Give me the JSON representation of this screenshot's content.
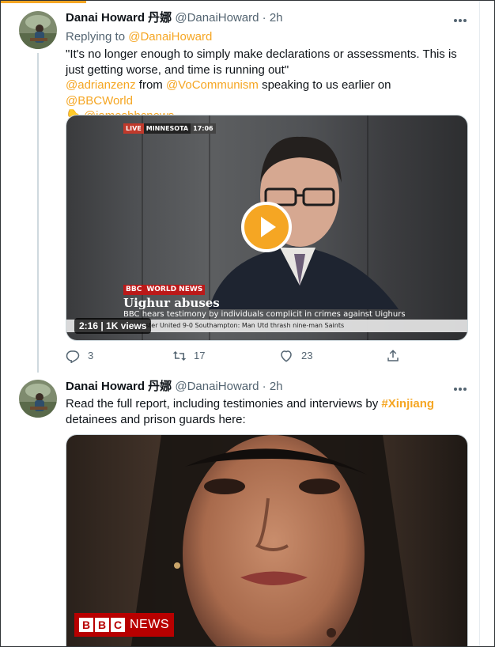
{
  "tweets": [
    {
      "author_name": "Danai Howard 丹娜",
      "handle": "@DanaiHoward",
      "separator": "·",
      "time": "2h",
      "replying_prefix": "Replying to",
      "replying_handle": "@DanaiHoward",
      "quote": "\"It's no longer enough to simply make declarations or assessments. This is just getting worse, and time is running out\"",
      "mention_1": "@adrianzenz",
      "from_word": "from",
      "mention_2": "@VoCommunism",
      "speaking_text": "speaking to us earlier on",
      "mention_3": "@BBCWorld",
      "point_emoji": "👇",
      "mention_4": "@jamesbbcnews",
      "video": {
        "live_label": "LIVE",
        "location": "MINNESOTA",
        "clock": "17:06",
        "bbc_letters": "BBC",
        "channel": "WORLD NEWS",
        "headline": "Uighur abuses",
        "subheadline": "BBC hears testimony by individuals complicit in crimes against Uighurs",
        "ticker": "hester United 9-0 Southampton: Man Utd thrash nine-man Saints",
        "duration": "2:16 | 1K views"
      },
      "actions": {
        "replies": "3",
        "retweets": "17",
        "likes": "23"
      }
    },
    {
      "author_name": "Danai Howard 丹娜",
      "handle": "@DanaiHoward",
      "separator": "·",
      "time": "2h",
      "text_before": "Read the full report, including testimonies and interviews by",
      "hashtag": "#Xinjiang",
      "text_after": "detainees and prison guards here:",
      "image": {
        "bbc_letters": [
          "B",
          "B",
          "C"
        ],
        "word": "NEWS"
      }
    }
  ],
  "colors": {
    "accent": "#f5a623",
    "muted": "#536471",
    "text": "#0f1419"
  },
  "icons": [
    "more-icon",
    "reply-icon",
    "retweet-icon",
    "like-icon",
    "share-icon",
    "play-icon"
  ]
}
